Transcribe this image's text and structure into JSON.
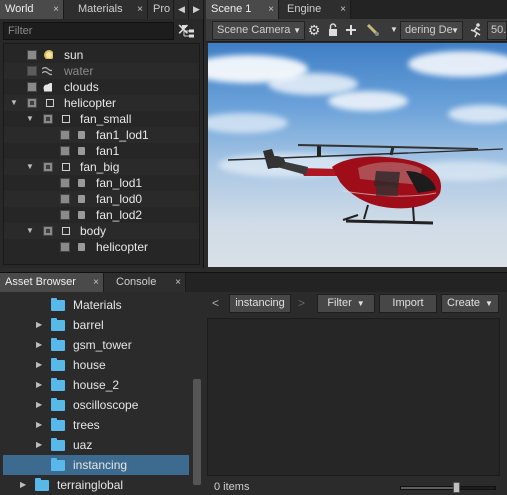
{
  "world_panel": {
    "tabs": [
      {
        "label": "World",
        "close": "×"
      },
      {
        "label": "Materials",
        "close": "×"
      },
      {
        "label": "Pro"
      }
    ],
    "nav_left": "◀",
    "nav_right": "▶",
    "filter_placeholder": "Filter",
    "clear_glyph": "✕",
    "tree": [
      {
        "label": "sun",
        "icon": "sun-icon"
      },
      {
        "label": "water",
        "icon": "water-icon",
        "dimmed": true
      },
      {
        "label": "clouds",
        "icon": "cloud-icon"
      },
      {
        "label": "helicopter",
        "icon": "none"
      },
      {
        "label": "fan_small",
        "icon": "node-box-icon"
      },
      {
        "label": "fan1_lod1",
        "icon": "mesh-icon"
      },
      {
        "label": "fan1",
        "icon": "mesh-icon"
      },
      {
        "label": "fan_big",
        "icon": "node-box-icon"
      },
      {
        "label": "fan_lod1",
        "icon": "mesh-icon"
      },
      {
        "label": "fan_lod0",
        "icon": "mesh-icon"
      },
      {
        "label": "fan_lod2",
        "icon": "mesh-icon"
      },
      {
        "label": "body",
        "icon": "node-box-icon"
      },
      {
        "label": "helicopter",
        "icon": "mesh-icon"
      }
    ]
  },
  "scene_panel": {
    "tabs": [
      {
        "label": "Scene 1",
        "close": "×"
      },
      {
        "label": "Engine",
        "close": "×"
      }
    ],
    "camera_select": "Scene Camera",
    "render_mode_select": "dering De",
    "speed_value": "50."
  },
  "asset_browser": {
    "tabs": [
      {
        "label": "Asset Browser",
        "close": "×"
      },
      {
        "label": "Console",
        "close": "×"
      }
    ],
    "folders": [
      {
        "label": "Materials",
        "expandable": false
      },
      {
        "label": "barrel",
        "expandable": true
      },
      {
        "label": "gsm_tower",
        "expandable": true
      },
      {
        "label": "house",
        "expandable": true
      },
      {
        "label": "house_2",
        "expandable": true
      },
      {
        "label": "oscilloscope",
        "expandable": true
      },
      {
        "label": "trees",
        "expandable": true
      },
      {
        "label": "uaz",
        "expandable": true
      },
      {
        "label": "instancing",
        "expandable": false,
        "selected": true
      },
      {
        "label": "terrainglobal",
        "expandable": true
      }
    ],
    "nav_back": "<",
    "nav_forward": ">",
    "breadcrumb": "instancing",
    "filter_button": "Filter",
    "import_button": "Import",
    "create_button": "Create",
    "status": "0 items",
    "thumbnail_size": 0.58
  },
  "colors": {
    "accent_folder": "#58b8ea",
    "selection": "#3d6b8f",
    "helicopter_body": "#9e0d18"
  }
}
